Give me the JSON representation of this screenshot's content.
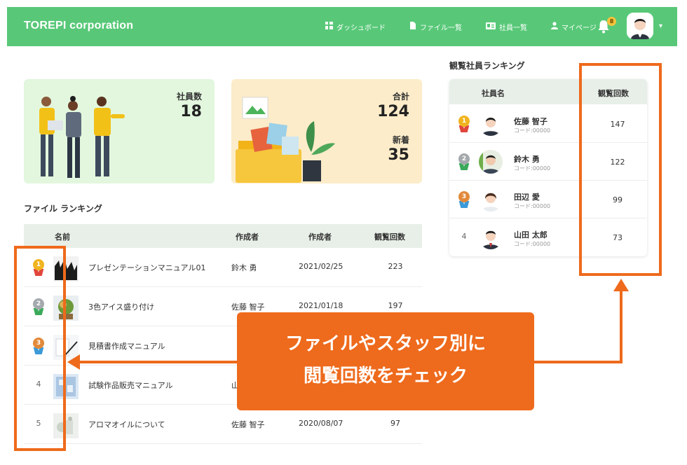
{
  "header": {
    "brand": "TOREPI corporation",
    "nav": [
      {
        "icon": "dashboard-icon",
        "label": "ダッシュボード"
      },
      {
        "icon": "file-icon",
        "label": "ファイル一覧"
      },
      {
        "icon": "id-card-icon",
        "label": "社員一覧"
      },
      {
        "icon": "user-icon",
        "label": "マイページ"
      }
    ],
    "notification_count": "8"
  },
  "stats": {
    "staff_label": "社員数",
    "staff_value": "18",
    "total_label": "合計",
    "total_value": "124",
    "new_label": "新着",
    "new_value": "35"
  },
  "file_ranking": {
    "title": "ファイル ランキング",
    "columns": {
      "name": "名前",
      "author": "作成者",
      "date": "作成者",
      "views": "観覧回数"
    },
    "rows": [
      {
        "rank": "1",
        "name": "プレゼンテーションマニュアル01",
        "author": "鈴木 勇",
        "date": "2021/02/25",
        "views": "223"
      },
      {
        "rank": "2",
        "name": "3色アイス盛り付け",
        "author": "佐藤 智子",
        "date": "2021/01/18",
        "views": "197"
      },
      {
        "rank": "3",
        "name": "見積書作成マニュアル",
        "author": "",
        "date": "",
        "views": ""
      },
      {
        "rank": "4",
        "name": "試験作品販売マニュアル",
        "author": "山",
        "date": "",
        "views": ""
      },
      {
        "rank": "5",
        "name": "アロマオイルについて",
        "author": "佐藤 智子",
        "date": "2020/08/07",
        "views": "97"
      }
    ]
  },
  "staff_ranking": {
    "title": "観覧社員ランキング",
    "columns": {
      "name": "社員名",
      "views": "観覧回数"
    },
    "rows": [
      {
        "rank": "1",
        "name": "佐藤 智子",
        "code": "コード:00000",
        "views": "147"
      },
      {
        "rank": "2",
        "name": "鈴木 勇",
        "code": "コード:00000",
        "views": "122"
      },
      {
        "rank": "3",
        "name": "田辺 愛",
        "code": "コード:00000",
        "views": "99"
      },
      {
        "rank": "4",
        "name": "山田 太郎",
        "code": "コード:00000",
        "views": "73"
      }
    ]
  },
  "callout": {
    "line1": "ファイルやスタッフ別に",
    "line2": "閲覧回数をチェック"
  },
  "colors": {
    "header_green": "#58c878",
    "annotation_orange": "#ee6a1c",
    "gold": "#f0b41e",
    "silver": "#a4a9ad",
    "bronze": "#e2893a"
  }
}
